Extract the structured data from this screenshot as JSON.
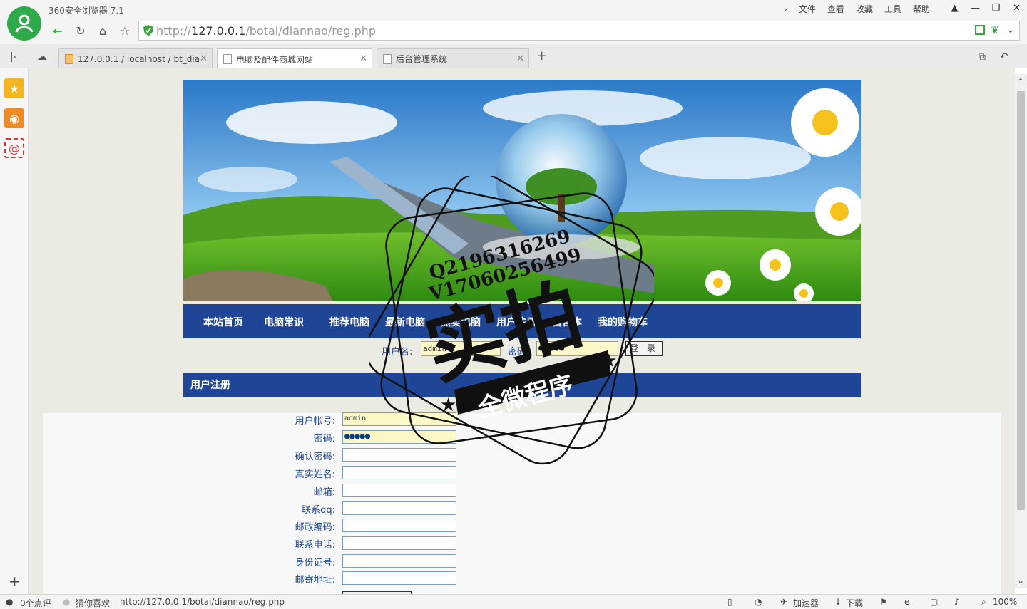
{
  "browser": {
    "app_title": "360安全浏览器 7.1",
    "menu": [
      "文件",
      "查看",
      "收藏",
      "工具",
      "帮助"
    ],
    "url_prefix": "http://",
    "url_host": "127.0.0.1",
    "url_path": "/botai/diannao/reg.php",
    "tabs": [
      {
        "label": "127.0.0.1 / localhost / bt_dia"
      },
      {
        "label": "电脑及配件商城网站"
      },
      {
        "label": "后台管理系统"
      }
    ]
  },
  "site": {
    "nav": [
      "本站首页",
      "电脑常识",
      "推荐电脑",
      "最新电脑",
      "热卖电脑",
      "用户注册",
      "留言本",
      "我的购物车"
    ],
    "login": {
      "username_label": "用户名:",
      "username_value": "admin",
      "password_label": "密码:",
      "password_value": "●●●●●",
      "login_button": "登 录"
    },
    "register_title": "用户注册",
    "form_fields": [
      {
        "label": "用户帐号:",
        "value": "admin"
      },
      {
        "label": "密码:",
        "value": "●●●●●"
      },
      {
        "label": "确认密码:",
        "value": ""
      },
      {
        "label": "真实姓名:",
        "value": ""
      },
      {
        "label": "邮箱:",
        "value": ""
      },
      {
        "label": "联系qq:",
        "value": ""
      },
      {
        "label": "邮政编码:",
        "value": ""
      },
      {
        "label": "联系电话:",
        "value": ""
      },
      {
        "label": "身份证号:",
        "value": ""
      },
      {
        "label": "邮寄地址:",
        "value": ""
      }
    ]
  },
  "watermark": {
    "line1": "Q2196316269",
    "line2": "V17060256499",
    "big": "实拍",
    "ribbon": "全微程序"
  },
  "status": {
    "comments": "0个点评",
    "guess": "猜你喜欢",
    "url": "http://127.0.0.1/botai/diannao/reg.php",
    "accelerator": "加速器",
    "download": "下载",
    "zoom": "100%"
  },
  "colors": {
    "nav_blue": "#1f4696",
    "input_yellow": "#fbf8c8",
    "brand_green": "#2eaa4a"
  }
}
